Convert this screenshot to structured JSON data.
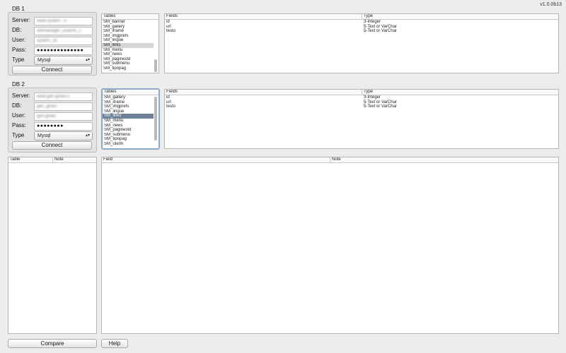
{
  "app": {
    "version": "v1.0.0b13"
  },
  "db1": {
    "title": "DB 1",
    "server_label": "Server:",
    "server_value": "www.system --s",
    "db_label": "DB:",
    "db_value": "sitemanager_ucamm_2",
    "user_label": "User:",
    "user_value": "system_vit",
    "pass_label": "Pass:",
    "pass_value": "●●●●●●●●●●●●●●",
    "type_label": "Type",
    "type_value": "Mysql",
    "connect_label": "Connect",
    "tables_header": "Tables",
    "tables": [
      "SM_banner",
      "SM_gallery",
      "SM_iframe",
      "SM_imgprefs",
      "SM_lingue",
      "SM_links",
      "SM_menu",
      "SM_news",
      "SM_paginestd",
      "SM_submenu",
      "SM_tipopag"
    ],
    "selected_table": "SM_links",
    "fields_header": "Fields",
    "type_header": "Type",
    "fields": [
      {
        "name": "id",
        "type": "3-Integer"
      },
      {
        "name": "url",
        "type": "5-Text or VarChar"
      },
      {
        "name": "testo",
        "type": "5-Text or VarChar"
      }
    ]
  },
  "db2": {
    "title": "DB 2",
    "server_label": "Server:",
    "server_value": "www.gen-grwer.it",
    "db_label": "DB:",
    "db_value": "gen_gmen",
    "user_label": "User:",
    "user_value": "gen-gmen",
    "pass_label": "Pass:",
    "pass_value": "●●●●●●●●",
    "type_label": "Type",
    "type_value": "Mysql",
    "connect_label": "Connect",
    "tables_header": "Tables",
    "tables": [
      "SM_gallery",
      "SM_iframe",
      "SM_imgprefs",
      "SM_lingue",
      "SM_links",
      "SM_menu",
      "SM_news",
      "SM_paginestd",
      "SM_submenu",
      "SM_tipopag",
      "SM_utenti"
    ],
    "selected_table": "SM_links",
    "fields_header": "Fields",
    "type_header": "Type",
    "fields": [
      {
        "name": "id",
        "type": "3-Integer"
      },
      {
        "name": "url",
        "type": "5-Text or VarChar"
      },
      {
        "name": "testo",
        "type": "5-Text or VarChar"
      }
    ]
  },
  "compare": {
    "table_header": "Table",
    "note_header": "Note",
    "field_header": "Field",
    "note2_header": "Note",
    "compare_label": "Compare",
    "help_label": "Help"
  }
}
